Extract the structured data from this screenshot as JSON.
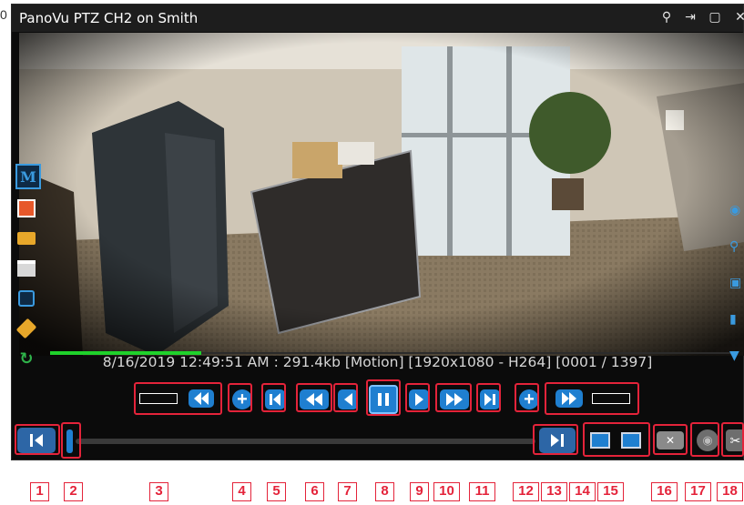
{
  "background_fragment": "0",
  "window": {
    "title": "PanoVu PTZ CH2 on Smith",
    "titlebar_icons": [
      "pin-icon",
      "exit-fullscreen-icon",
      "maximize-icon",
      "close-icon"
    ],
    "info_line": "8/16/2019 12:49:51 AM : 291.4kb [Motion] [1920x1080 - H264] [0001 / 1397]",
    "playback_progress": 0.22
  },
  "left_toolbar": [
    "motion-icon",
    "stop-record-icon",
    "export-icon",
    "print-icon",
    "snapshot-icon",
    "tag-icon",
    "sync-remove-icon"
  ],
  "right_toolbar": [
    "binoculars-icon",
    "search-icon",
    "image-icon",
    "microphone-icon",
    "ptz-icon"
  ],
  "callout_labels": [
    "1",
    "2",
    "3",
    "4",
    "5",
    "6",
    "7",
    "8",
    "9",
    "10",
    "11",
    "12",
    "13",
    "14",
    "15",
    "16",
    "17",
    "18"
  ],
  "colors": {
    "accent": "#1f7fd0",
    "callout": "#e4233a",
    "progress": "#1fd22b",
    "window_bg": "#0b0b0b"
  }
}
